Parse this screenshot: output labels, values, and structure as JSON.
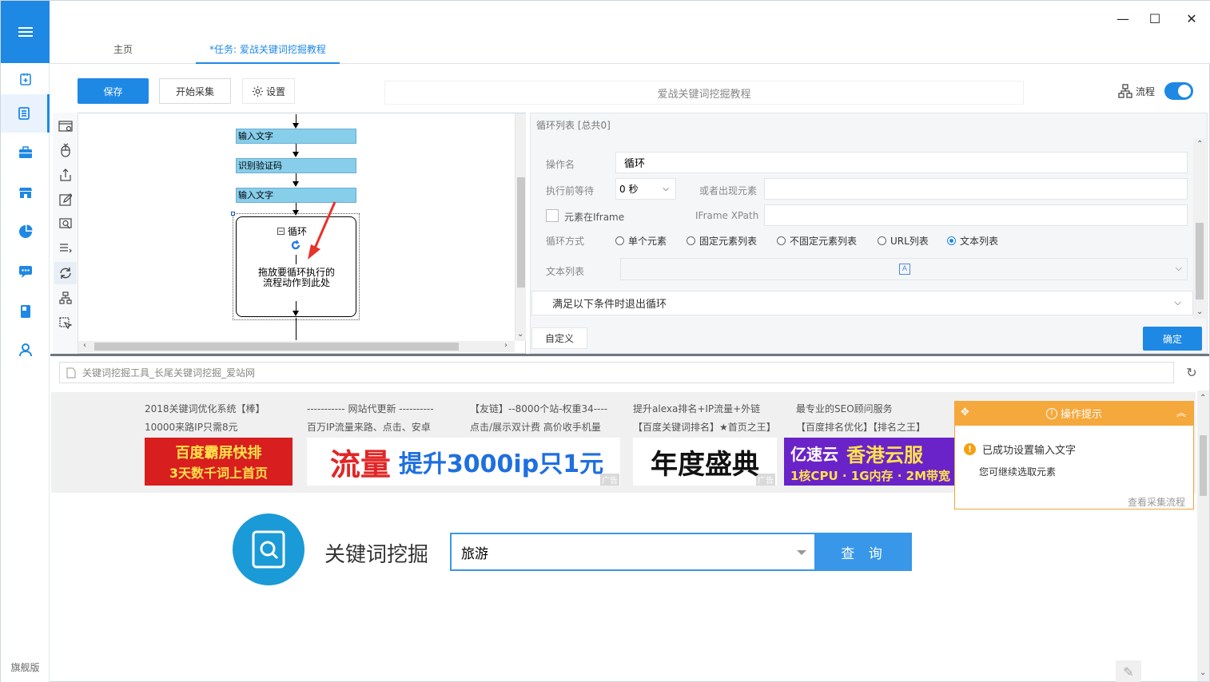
{
  "window": {
    "minimize": "—",
    "maximize": "☐",
    "close": "✕"
  },
  "tabs": {
    "home": "主页",
    "task": "*任务: 爱战关键词挖掘教程"
  },
  "toolbar": {
    "save": "保存",
    "start": "开始采集",
    "settings": "设置",
    "task_title": "爱战关键词挖掘教程",
    "flow": "流程",
    "flow_enabled": true
  },
  "sidebar": {
    "items": [
      "task-add-icon",
      "doc-list-icon",
      "briefcase-icon",
      "store-icon",
      "pie-chart-icon",
      "chat-icon",
      "book-icon",
      "user-icon"
    ],
    "active_index": 1,
    "edition": "旗舰版"
  },
  "flow": {
    "steps": [
      "输入文字",
      "识别验证码",
      "输入文字"
    ],
    "loop_title": "循环",
    "loop_hint": "拖放要循环执行的流程动作到此处"
  },
  "config": {
    "header": "循环列表 [总共0]",
    "op_name_label": "操作名",
    "op_name_value": "循环",
    "wait_label": "执行前等待",
    "wait_value": "0 秒",
    "or_appear_label": "或者出现元素",
    "iframe_label": "元素在Iframe",
    "iframe_xpath_label": "IFrame XPath",
    "loop_mode_label": "循环方式",
    "loop_modes": [
      "单个元素",
      "固定元素列表",
      "不固定元素列表",
      "URL列表",
      "文本列表"
    ],
    "loop_mode_selected": 4,
    "text_list_label": "文本列表",
    "exit_condition": "满足以下条件时退出循环",
    "custom_btn": "自定义",
    "ok_btn": "确定"
  },
  "browser": {
    "address": "关键词挖掘工具_长尾关键词挖掘_爱站网",
    "ads_text": [
      [
        "2018关键词优化系统【棒】",
        "10000来路IP只需8元"
      ],
      [
        "----------- 网站代更新 ----------",
        "百万IP流量来路、点击、安卓"
      ],
      [
        "【友链】--8000个站-权重34----",
        "点击/展示双计费 高价收手机量"
      ],
      [
        "提升alexa排名+IP流量+外链",
        "【百度关键词排名】★首页之王】"
      ],
      [
        "最专业的SEO顾问服务",
        "【百度排名优化】【排名之王】"
      ]
    ],
    "ad_banners": [
      [
        "百度霸屏快排",
        "3天数千词上首页"
      ],
      [
        "流量",
        "提升3000ip只1元"
      ],
      [
        "年度盛典"
      ],
      [
        "亿速云",
        "香港云服",
        "1核CPU · 1G内存 · 2M带宽"
      ]
    ],
    "ad_tag": "广告",
    "kw_title": "关键词挖掘",
    "search_value": "旅游",
    "search_btn": "查 询"
  },
  "tip": {
    "title": "操作提示",
    "message": "已成功设置输入文字",
    "sub": "您可继续选取元素",
    "link": "查看采集流程"
  }
}
